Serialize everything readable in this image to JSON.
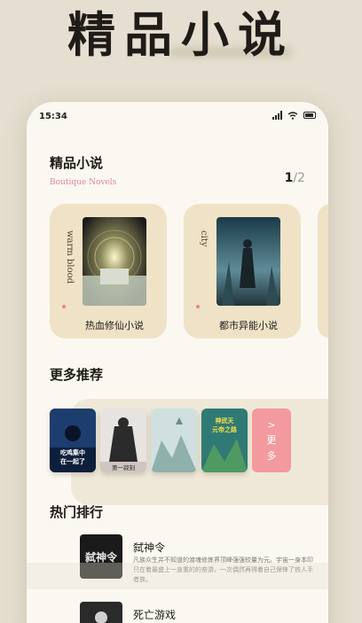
{
  "banner": {
    "title": "精品小说"
  },
  "status": {
    "time": "15:34"
  },
  "section1": {
    "title": "精品小说",
    "subtitle": "Boutique Novels",
    "page_current": "1",
    "page_total": "/2",
    "cards": [
      {
        "tag": "warm blood",
        "name": "热血修仙小说"
      },
      {
        "tag": "city",
        "name": "都市异能小说"
      }
    ]
  },
  "section2": {
    "title": "更多推荐",
    "covers": [
      {
        "text_line1": "吃鸡集中",
        "text_line2": "在一起了"
      },
      {
        "text_line1": "第一寂刻"
      },
      {
        "text_line1": ""
      },
      {
        "text_line1": "神武天",
        "text_line2": "元帝之路"
      }
    ],
    "more_arrow": ">",
    "more_label_1": "更",
    "more_label_2": "多"
  },
  "section3": {
    "title": "热门排行",
    "items": [
      {
        "title": "弑神令",
        "desc": "凡族众生并不知道的渡魂修炼界顶峰强强较量为元。宇宙一身本印只在着最盛上一身重的的奋游，一次偶然再得着自己保锋了铁人手者族。",
        "cover_text": "弑神令"
      },
      {
        "title": "死亡游戏",
        "desc": "",
        "cover_text": ""
      }
    ]
  },
  "colors": {
    "accent_pink": "#e0849a",
    "more_button": "#f29a9e",
    "card_bg": "#efe2c6"
  }
}
